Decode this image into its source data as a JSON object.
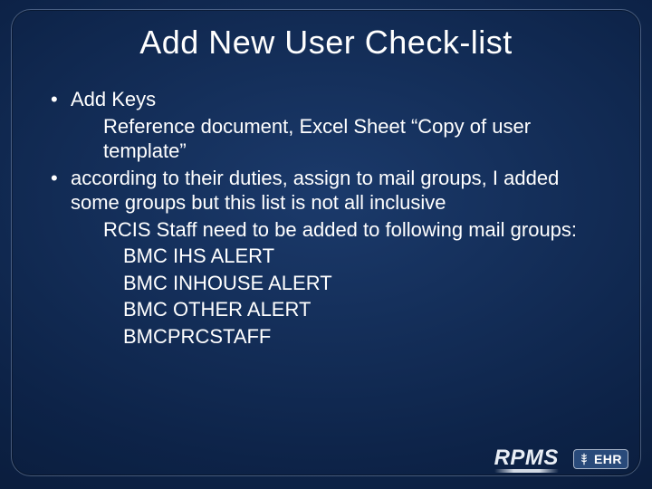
{
  "title": "Add New User Check-list",
  "bullets": [
    {
      "text": "Add Keys",
      "sub": [
        "Reference document, Excel Sheet “Copy of user template”"
      ]
    },
    {
      "text": "according to their duties, assign to mail groups, I added some groups but this list is not all inclusive",
      "sub": [
        "RCIS Staff need to be added to following mail groups:"
      ],
      "sub2": [
        "BMC IHS ALERT",
        "BMC INHOUSE ALERT",
        "BMC OTHER ALERT",
        "BMCPRCSTAFF"
      ]
    }
  ],
  "footer": {
    "rpms": "RPMS",
    "ehr": "EHR"
  }
}
